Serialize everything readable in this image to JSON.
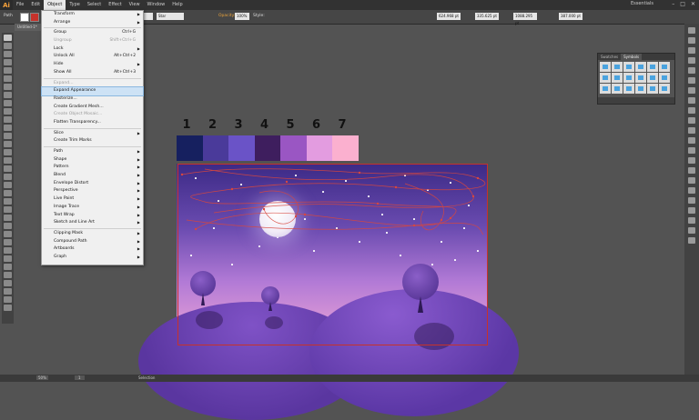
{
  "app": {
    "logo": "Ai",
    "workspace": "Essentials"
  },
  "menubar": {
    "items": [
      "File",
      "Edit",
      "Object",
      "Type",
      "Select",
      "Effect",
      "View",
      "Window",
      "Help"
    ],
    "active": "Object"
  },
  "control_bar": {
    "selection": "Path",
    "stroke_style": "5 pt. Round",
    "preset": "Star",
    "opacity_label": "Opacity:",
    "opacity": "100%",
    "style_label": "Style:",
    "x": "624.968 pt",
    "y": "335.625 pt",
    "w": "1088.295 pt",
    "h": "387.000 pt"
  },
  "document_tab": {
    "title": "Untitled-1*"
  },
  "object_menu": [
    {
      "label": "Transform",
      "submenu": true
    },
    {
      "label": "Arrange",
      "submenu": true
    },
    {
      "sep": true
    },
    {
      "label": "Group",
      "shortcut": "Ctrl+G"
    },
    {
      "label": "Ungroup",
      "shortcut": "Shift+Ctrl+G",
      "disabled": true
    },
    {
      "label": "Lock",
      "submenu": true
    },
    {
      "label": "Unlock All",
      "shortcut": "Alt+Ctrl+2"
    },
    {
      "label": "Hide",
      "submenu": true
    },
    {
      "label": "Show All",
      "shortcut": "Alt+Ctrl+3"
    },
    {
      "sep": true
    },
    {
      "label": "Expand...",
      "disabled": true
    },
    {
      "label": "Expand Appearance",
      "highlighted": true
    },
    {
      "label": "Rasterize..."
    },
    {
      "label": "Create Gradient Mesh..."
    },
    {
      "label": "Create Object Mosaic...",
      "disabled": true
    },
    {
      "label": "Flatten Transparency..."
    },
    {
      "sep": true
    },
    {
      "label": "Slice",
      "submenu": true
    },
    {
      "label": "Create Trim Marks"
    },
    {
      "sep": true
    },
    {
      "label": "Path",
      "submenu": true
    },
    {
      "label": "Shape",
      "submenu": true
    },
    {
      "label": "Pattern",
      "submenu": true
    },
    {
      "label": "Blend",
      "submenu": true
    },
    {
      "label": "Envelope Distort",
      "submenu": true
    },
    {
      "label": "Perspective",
      "submenu": true
    },
    {
      "label": "Live Paint",
      "submenu": true
    },
    {
      "label": "Image Trace",
      "submenu": true
    },
    {
      "label": "Text Wrap",
      "submenu": true
    },
    {
      "label": "Sketch and Line Art",
      "submenu": true
    },
    {
      "sep": true
    },
    {
      "label": "Clipping Mask",
      "submenu": true
    },
    {
      "label": "Compound Path",
      "submenu": true
    },
    {
      "label": "Artboards",
      "submenu": true
    },
    {
      "label": "Graph",
      "submenu": true
    }
  ],
  "symbols_panel": {
    "tabs": [
      "Swatches",
      "Symbols"
    ],
    "active": "Symbols"
  },
  "palette": {
    "numbers": [
      "1",
      "2",
      "3",
      "4",
      "5",
      "6",
      "7"
    ],
    "colors": [
      "#16205f",
      "#4a3a9a",
      "#6a53c7",
      "#3e1e5e",
      "#9a56c3",
      "#e39ce0",
      "#fbb0cf"
    ]
  },
  "status": {
    "zoom": "50%",
    "page": "1",
    "tool": "Selection"
  }
}
